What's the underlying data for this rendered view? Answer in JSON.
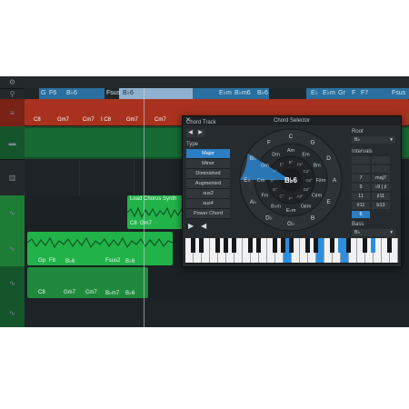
{
  "colors": {
    "accent": "#2b7ec4",
    "red_track": "#a8321f",
    "green_track": "#1f8a3e",
    "bright_green_clip": "#22b24a",
    "chord_lane": "#2a6f9f"
  },
  "chord_track_top": [
    "G",
    "F6",
    "B♭6",
    "Fsus",
    "B♭6",
    "E♭m",
    "B♭m6",
    "B♭6",
    "E♭",
    "E♭m",
    "Gr",
    "F",
    "F7",
    "Fsus"
  ],
  "red_clip_chords": [
    "C8",
    "Gm7",
    "Cm7",
    "I C8",
    "Gm7",
    "Cm7"
  ],
  "lead_clip": {
    "name": "Lead Chorus Synth",
    "chords": [
      "C8",
      "Gm7"
    ]
  },
  "green_clip_chords": [
    "Gp",
    "F8",
    "B♭6",
    "Fsus2",
    "B♭6"
  ],
  "green_clip2_chords": [
    "C8",
    "Gm7",
    "Cm7",
    "B♭m7",
    "B♭6"
  ],
  "dialog": {
    "title": "Chord Selector",
    "tab": "Chord Track",
    "close_icon": "✕",
    "prev_icon": "◀",
    "next_icon": "▶",
    "type_label": "Type",
    "types": [
      "Major",
      "Minor",
      "Diminished",
      "Augmented",
      "sus2",
      "sus4",
      "Power Chord"
    ],
    "selected_type": "Major",
    "wheel_center": "B♭6",
    "wheel_outer": [
      "C",
      "G",
      "D",
      "A",
      "E",
      "B",
      "G♭",
      "D♭",
      "A♭",
      "E♭",
      "B♭",
      "F"
    ],
    "wheel_middle": [
      "Am",
      "Em",
      "Bm",
      "F♯m",
      "C♯m",
      "G♯m",
      "E♭m",
      "B♭m",
      "Fm",
      "Cm",
      "Gm",
      "Dm"
    ],
    "wheel_inner": [
      "B°",
      "F♯°",
      "C♯°",
      "G♯°",
      "D♯°",
      "A♯°",
      "F°",
      "C°",
      "G°",
      "D°",
      "A°",
      "E°"
    ],
    "root_label": "Root",
    "root_value": "B♭",
    "intervals_label": "Intervals",
    "intervals": [
      [
        "",
        ""
      ],
      [
        "",
        ""
      ],
      [
        "7",
        "maj7"
      ],
      [
        "9",
        "♭9 | ♯"
      ],
      [
        "11",
        "♯11"
      ],
      [
        "#11",
        "b13"
      ],
      [
        "6",
        ""
      ]
    ],
    "bass_label": "Bass",
    "bass_value": "B♭"
  }
}
